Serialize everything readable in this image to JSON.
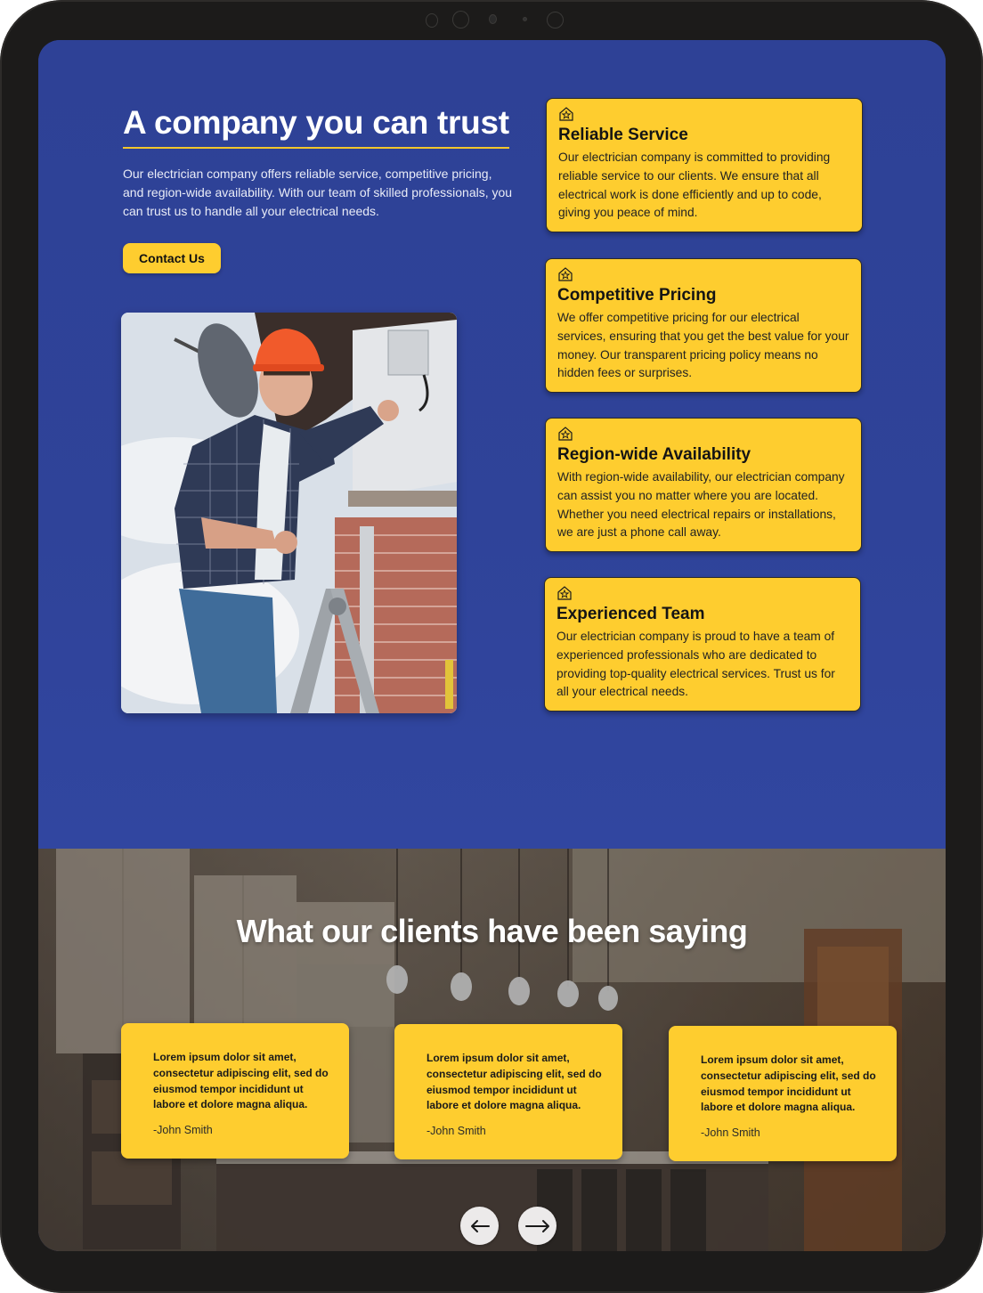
{
  "colors": {
    "primary_blue": "#2f4399",
    "accent_yellow": "#fecd2f",
    "text_dark": "#141414",
    "text_light": "#ffffff"
  },
  "hero": {
    "title": "A company you can trust",
    "description": "Our electrician company offers reliable service, competitive pricing, and region-wide availability. With our team of skilled professionals, you can trust us to handle all your electrical needs.",
    "contact_button_label": "Contact Us",
    "image_alt": "Electrician in hard hat on ladder next to air conditioning unit"
  },
  "features": [
    {
      "icon": "house-star-icon",
      "title": "Reliable Service",
      "text": "Our electrician company is committed to providing reliable service to our clients. We ensure that all electrical work is done efficiently and up to code, giving you peace of mind."
    },
    {
      "icon": "house-star-icon",
      "title": "Competitive Pricing",
      "text": "We offer competitive pricing for our electrical services, ensuring that you get the best value for your money. Our transparent pricing policy means no hidden fees or surprises."
    },
    {
      "icon": "house-star-icon",
      "title": "Region-wide Availability",
      "text": "With region-wide availability, our electrician company can assist you no matter where you are located. Whether you need electrical repairs or installations, we are just a phone call away."
    },
    {
      "icon": "house-star-icon",
      "title": "Experienced Team",
      "text": "Our electrician company is proud to have a team of experienced professionals who are dedicated to providing top-quality electrical services. Trust us for all your electrical needs."
    }
  ],
  "testimonials": {
    "title": "What our clients have been saying",
    "items": [
      {
        "quote": "Lorem ipsum dolor sit amet, consectetur adipiscing elit, sed do eiusmod tempor incididunt ut labore et dolore magna aliqua.",
        "author": "-John Smith"
      },
      {
        "quote": "Lorem ipsum dolor sit amet, consectetur adipiscing elit, sed do eiusmod tempor incididunt ut labore et dolore magna aliqua.",
        "author": "-John Smith"
      },
      {
        "quote": "Lorem ipsum dolor sit amet, consectetur adipiscing elit, sed do eiusmod tempor incididunt ut labore et dolore magna aliqua.",
        "author": "-John Smith"
      }
    ],
    "prev_icon": "arrow-left-icon",
    "next_icon": "arrow-right-icon"
  }
}
